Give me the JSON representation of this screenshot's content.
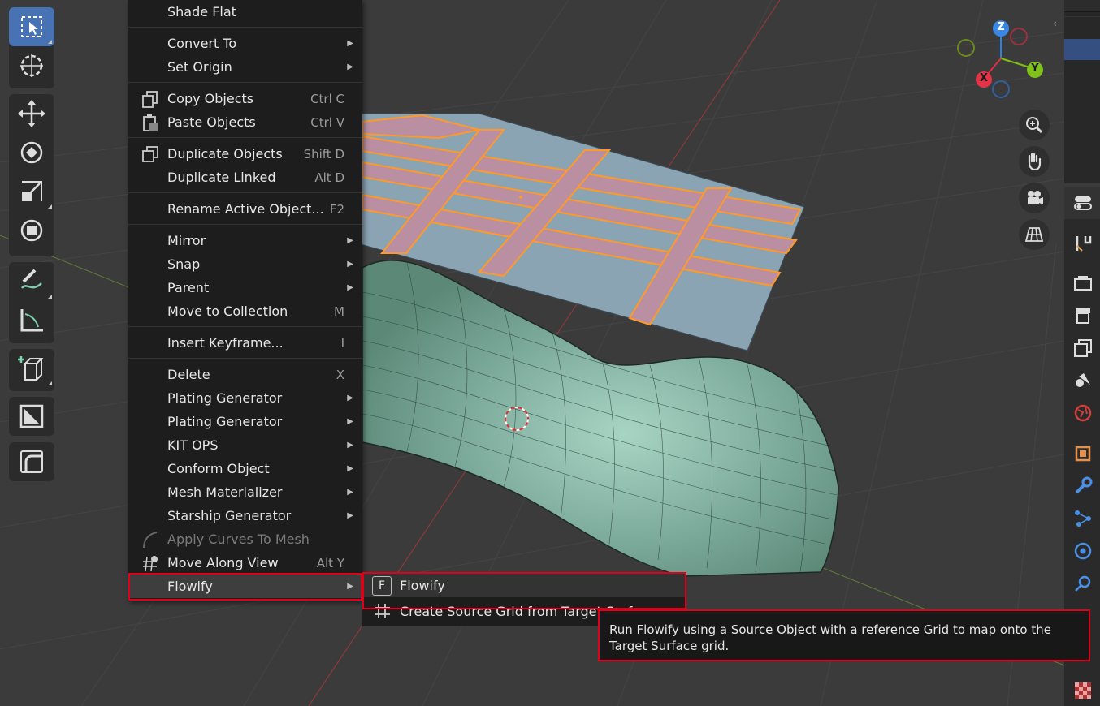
{
  "menu": {
    "items": [
      {
        "label": "Shade Flat",
        "shortcut": "",
        "submenu": false
      },
      {
        "label": "Convert To",
        "shortcut": "",
        "submenu": true
      },
      {
        "label": "Set Origin",
        "shortcut": "",
        "submenu": true
      },
      {
        "label": "Copy Objects",
        "shortcut": "Ctrl C",
        "submenu": false,
        "icon": "copy-icon"
      },
      {
        "label": "Paste Objects",
        "shortcut": "Ctrl V",
        "submenu": false,
        "icon": "paste-icon"
      },
      {
        "label": "Duplicate Objects",
        "shortcut": "Shift D",
        "submenu": false,
        "icon": "duplicate-icon"
      },
      {
        "label": "Duplicate Linked",
        "shortcut": "Alt D",
        "submenu": false
      },
      {
        "label": "Rename Active Object...",
        "shortcut": "F2",
        "submenu": false
      },
      {
        "label": "Mirror",
        "shortcut": "",
        "submenu": true
      },
      {
        "label": "Snap",
        "shortcut": "",
        "submenu": true
      },
      {
        "label": "Parent",
        "shortcut": "",
        "submenu": true
      },
      {
        "label": "Move to Collection",
        "shortcut": "M",
        "submenu": false
      },
      {
        "label": "Insert Keyframe...",
        "shortcut": "I",
        "submenu": false
      },
      {
        "label": "Delete",
        "shortcut": "X",
        "submenu": false
      },
      {
        "label": "Plating Generator",
        "shortcut": "",
        "submenu": true
      },
      {
        "label": "Plating Generator",
        "shortcut": "",
        "submenu": true
      },
      {
        "label": "KIT OPS",
        "shortcut": "",
        "submenu": true
      },
      {
        "label": "Conform Object",
        "shortcut": "",
        "submenu": true
      },
      {
        "label": "Mesh Materializer",
        "shortcut": "",
        "submenu": true
      },
      {
        "label": "Starship Generator",
        "shortcut": "",
        "submenu": true
      },
      {
        "label": "Apply Curves To Mesh",
        "shortcut": "",
        "submenu": false,
        "disabled": true,
        "icon": "curve-icon"
      },
      {
        "label": "Move Along View",
        "shortcut": "Alt Y",
        "submenu": false,
        "icon": "move-view-icon"
      },
      {
        "label": "Flowify",
        "shortcut": "",
        "submenu": true,
        "highlighted": true
      }
    ]
  },
  "submenu": {
    "items": [
      {
        "label": "Flowify",
        "icon": "f-key-icon"
      },
      {
        "label": "Create Source Grid from Target Surf",
        "icon": "grid-icon"
      }
    ]
  },
  "tooltip": {
    "text": "Run Flowify using a Source Object with a reference Grid to map onto the Target Surface grid."
  },
  "gizmo": {
    "z_label": "Z",
    "y_label": "Y",
    "x_label": "X",
    "colors": {
      "x": "#e03040",
      "y": "#80c010",
      "z": "#3080e0"
    }
  },
  "toolbar": {
    "tools": [
      "select-box-icon",
      "cursor-icon",
      "move-icon",
      "rotate-icon",
      "scale-icon",
      "transform-icon",
      "annotate-icon",
      "measure-icon",
      "add-cube-icon",
      "grease-icon",
      "bevel-icon"
    ]
  },
  "colors": {
    "highlight_red": "#e0001a",
    "mesh_green": "#7fb0a0",
    "plating_pink": "#b890a0",
    "selection_orange": "#ff9a2a",
    "active_tool_blue": "#4772b3"
  }
}
